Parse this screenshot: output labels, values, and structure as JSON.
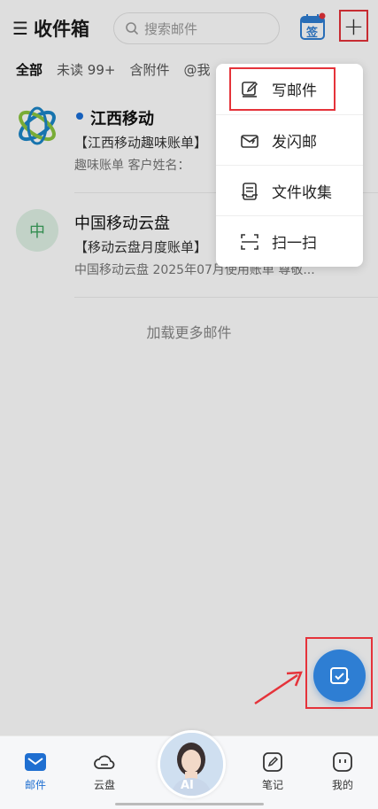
{
  "header": {
    "title": "收件箱",
    "search_placeholder": "搜索邮件",
    "checkin_label": "签"
  },
  "tabs": [
    {
      "label": "全部",
      "active": true
    },
    {
      "label": "未读 99+",
      "active": false
    },
    {
      "label": "含附件",
      "active": false
    },
    {
      "label": "@我",
      "active": false
    }
  ],
  "mails": [
    {
      "sender": "江西移动",
      "unread": true,
      "subject": "【江西移动趣味账单】",
      "preview": "趣味账单 客户姓名："
    },
    {
      "sender": "中国移动云盘",
      "unread": false,
      "avatar_text": "中",
      "subject": "【移动云盘月度账单】",
      "preview": "中国移动云盘 2025年07月使用账单 尊敬..."
    }
  ],
  "load_more": "加载更多邮件",
  "dropdown": [
    {
      "label": "写邮件",
      "icon": "compose-icon"
    },
    {
      "label": "发闪邮",
      "icon": "flash-mail-icon"
    },
    {
      "label": "文件收集",
      "icon": "file-collect-icon"
    },
    {
      "label": "扫一扫",
      "icon": "scan-icon"
    }
  ],
  "nav": [
    {
      "label": "邮件",
      "icon": "mail-icon",
      "active": true
    },
    {
      "label": "云盘",
      "icon": "cloud-icon",
      "active": false
    },
    {
      "label": "AI",
      "icon": "ai-avatar",
      "active": false
    },
    {
      "label": "笔记",
      "icon": "note-icon",
      "active": false
    },
    {
      "label": "我的",
      "icon": "profile-icon",
      "active": false
    }
  ],
  "colors": {
    "accent": "#2e7ed3",
    "highlight": "#e5333a",
    "unread_dot": "#1a6fd8"
  }
}
